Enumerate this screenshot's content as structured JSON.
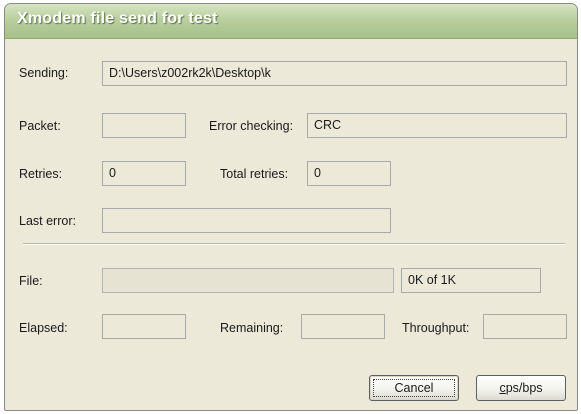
{
  "window": {
    "title": "Xmodem file send for test"
  },
  "fields": {
    "sending": {
      "label": "Sending:",
      "value": "D:\\Users\\z002rk2k\\Desktop\\k"
    },
    "packet": {
      "label": "Packet:",
      "value": ""
    },
    "error_checking": {
      "label": "Error checking:",
      "value": "CRC"
    },
    "retries": {
      "label": "Retries:",
      "value": "0"
    },
    "total_retries": {
      "label": "Total retries:",
      "value": "0"
    },
    "last_error": {
      "label": "Last error:",
      "value": ""
    },
    "file": {
      "label": "File:",
      "progress": 0,
      "size_text": "0K of 1K"
    },
    "elapsed": {
      "label": "Elapsed:",
      "value": ""
    },
    "remaining": {
      "label": "Remaining:",
      "value": ""
    },
    "throughput": {
      "label": "Throughput:",
      "value": ""
    }
  },
  "buttons": {
    "cancel": "Cancel",
    "cps_bps": "cps/bps"
  },
  "colors": {
    "titlebar": "#b9cf9f",
    "dialog_bg": "#ece9d8",
    "field_border": "#a9a9a9"
  }
}
